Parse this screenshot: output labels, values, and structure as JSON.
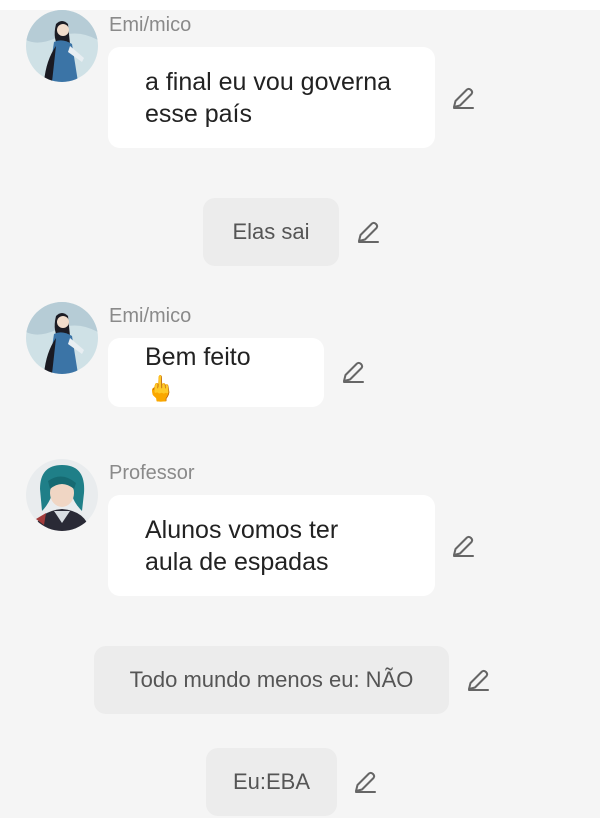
{
  "messages": [
    {
      "sender": "Emi/mico",
      "text": "a final eu vou governa\nesse país"
    },
    {
      "narration": "Elas sai"
    },
    {
      "sender": "Emi/mico",
      "text": "Bem feito 🖕"
    },
    {
      "sender": "Professor",
      "text": "Alunos vomos ter\naula de espadas"
    },
    {
      "narration": "Todo mundo menos eu: NÃO"
    },
    {
      "narration": "Eu:EBA"
    }
  ],
  "icons": {
    "edit": "pencil-icon",
    "avatar_girl": "avatar-anime-girl",
    "avatar_professor": "avatar-anime-professor"
  },
  "colors": {
    "background": "#f5f5f5",
    "bubble": "#ffffff",
    "narration_bubble": "#ececec",
    "sender_name": "#8a8a8a",
    "icon": "#666666"
  }
}
